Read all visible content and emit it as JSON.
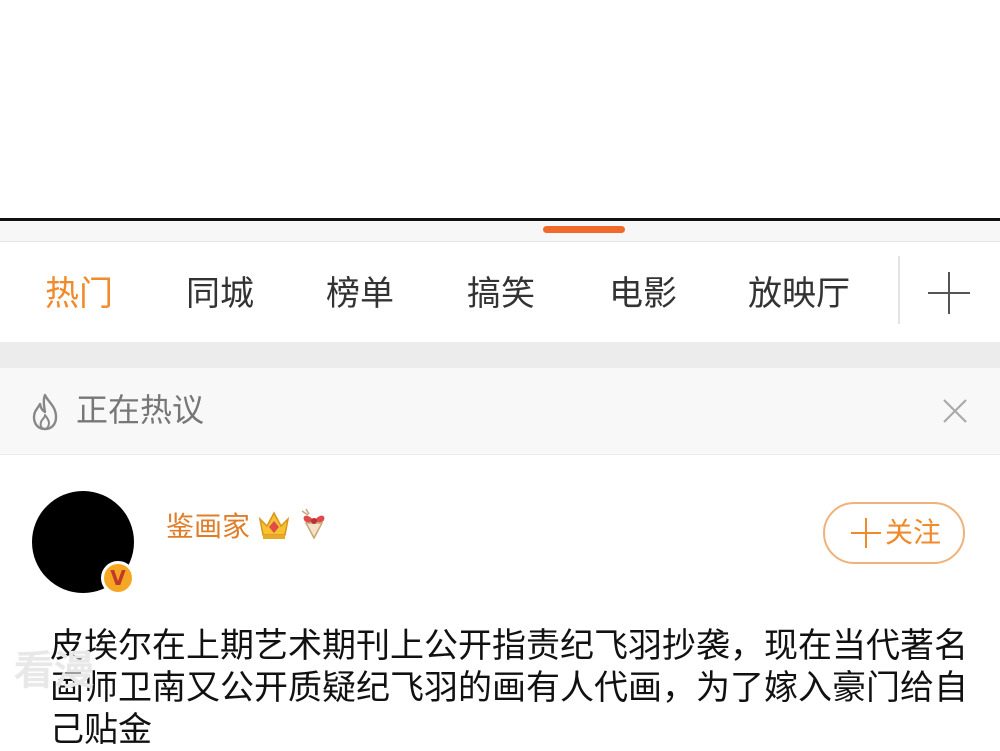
{
  "tabs": [
    {
      "label": "热门",
      "active": true
    },
    {
      "label": "同城",
      "active": false
    },
    {
      "label": "榜单",
      "active": false
    },
    {
      "label": "搞笑",
      "active": false
    },
    {
      "label": "电影",
      "active": false
    },
    {
      "label": "放映厅",
      "active": false
    }
  ],
  "hot_topic": {
    "label": "正在热议"
  },
  "post": {
    "username": "鉴画家",
    "follow_label": "关注",
    "verified_badge": "V",
    "content": "皮埃尔在上期艺术期刊上公开指责纪飞羽抄袭，现在当代著名画师卫南又公开质疑纪飞羽的画有人代画，为了嫁入豪门给自己贴金"
  },
  "watermark": "看漫",
  "colors": {
    "accent": "#f08a2a",
    "handle": "#f06a2c",
    "username": "#e07d28"
  },
  "icons": [
    "fire-icon",
    "close-icon",
    "crown-icon",
    "gift-icon",
    "plus-icon",
    "verified-v-icon"
  ]
}
